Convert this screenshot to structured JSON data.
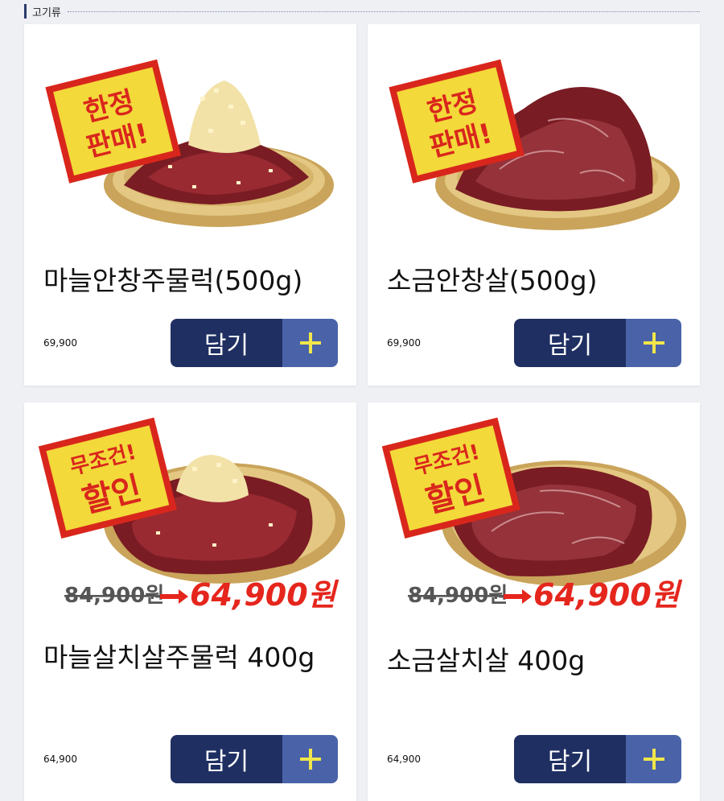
{
  "section": {
    "title": "고기류"
  },
  "products": [
    {
      "name": "마늘안창주물럭(500g)",
      "price": "69,900",
      "button_label": "담기",
      "badge": [
        "한정",
        "판매!"
      ],
      "garlic": true,
      "sale": null
    },
    {
      "name": "소금안창살(500g)",
      "price": "69,900",
      "button_label": "담기",
      "badge": [
        "한정",
        "판매!"
      ],
      "garlic": false,
      "sale": null
    },
    {
      "name": "마늘살치살주물럭 400g",
      "price": "64,900",
      "button_label": "담기",
      "badge": [
        "무조건!",
        "할인"
      ],
      "garlic": true,
      "sale": {
        "old": "84,900원",
        "new": "64,900원"
      }
    },
    {
      "name": "소금살치살 400g",
      "price": "64,900",
      "button_label": "담기",
      "badge": [
        "무조건!",
        "할인"
      ],
      "garlic": false,
      "sale": {
        "old": "84,900원",
        "new": "64,900원"
      }
    }
  ],
  "colors": {
    "button_dark": "#1f2f62",
    "button_light": "#4a63a8",
    "plus": "#f1e64a",
    "badge_bg": "#f3d93a",
    "badge_border": "#d9261c",
    "sale_red": "#e5261d"
  }
}
